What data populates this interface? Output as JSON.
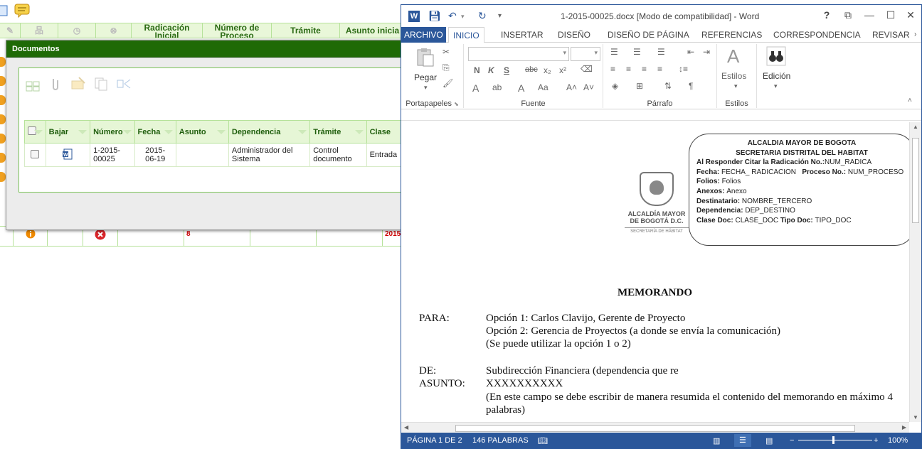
{
  "background": {
    "header_columns": [
      "Radicación Inicial",
      "Número de Proceso",
      "Trámite",
      "Asunto inicia"
    ],
    "row_values": [
      "8",
      "2015"
    ]
  },
  "dialog": {
    "title": "Documentos",
    "columns": [
      "Bajar",
      "Número",
      "Fecha",
      "Asunto",
      "Dependencia",
      "Trámite",
      "Clase"
    ],
    "rows": [
      {
        "numero_line1": "1-2015-",
        "numero_line2": "00025",
        "fecha_line1": "2015-",
        "fecha_line2": "06-19",
        "asunto": "",
        "dependencia_line1": "Administrador del",
        "dependencia_line2": "Sistema",
        "tramite_line1": "Control",
        "tramite_line2": "documento",
        "clase": "Entrada"
      }
    ]
  },
  "word": {
    "title": "1-2015-00025.docx [Modo de compatibilidad] - Word",
    "help": "?",
    "tabs": [
      "ARCHIVO",
      "INICIO",
      "INSERTAR",
      "DISEÑO",
      "DISEÑO DE PÁGINA",
      "REFERENCIAS",
      "CORRESPONDENCIA",
      "REVISAR"
    ],
    "ribbon": {
      "paste_label": "Pegar",
      "clipboard_label": "Portapapeles",
      "font_label": "Fuente",
      "paragraph_label": "Párrafo",
      "styles_label": "Estilos",
      "styles_button": "Estilos",
      "editing_button": "Edición"
    },
    "document": {
      "box": {
        "line1": "ALCALDIA MAYOR DE BOGOTA",
        "line2": "SECRETARIA DISTRITAL DEL HABITAT",
        "responder_label": "Al Responder Citar la Radicación No.:",
        "responder_value": "NUM_RADICA",
        "fecha_label": "Fecha: ",
        "fecha_value": "FECHA_ RADICACION",
        "proceso_label": "Proceso No.: ",
        "proceso_value": "NUM_PROCESO",
        "folios_label": "Folios: ",
        "folios_value": "Folios",
        "anexos_label": "Anexos: ",
        "anexos_value": "Anexo",
        "destinatario_label": "Destinatario: ",
        "destinatario_value": "NOMBRE_TERCERO",
        "dependencia_label": "Dependencia: ",
        "dependencia_value": "DEP_DESTINO",
        "clase_label": "Clase Doc: ",
        "clase_value": "CLASE_DOC ",
        "tipo_label": "Tipo Doc: ",
        "tipo_value": "TIPO_DOC"
      },
      "logo": {
        "line1": "ALCALDÍA MAYOR",
        "line2": "DE BOGOTÁ D.C.",
        "line3": "SECRETARÍA DE HÁBITAT"
      },
      "memo_title": "MEMORANDO",
      "para_label": "PARA:",
      "para_lines": [
        "Opción 1: Carlos Clavijo, Gerente de Proyecto",
        "Opción 2: Gerencia de Proyectos (a donde se envía la comunicación)",
        "(Se puede utilizar la opción 1 o 2)"
      ],
      "de_label": "DE:",
      "de_value": "Subdirección Financiera (dependencia que re",
      "asunto_label": "ASUNTO:",
      "asunto_value": "XXXXXXXXXX",
      "asunto_note": "(En este campo se debe escribir de manera resumida el contenido del memorando en máximo 4 palabras)"
    },
    "status": {
      "page": "PÁGINA 1 DE 2",
      "words": "146 PALABRAS",
      "zoom": "100%"
    }
  }
}
